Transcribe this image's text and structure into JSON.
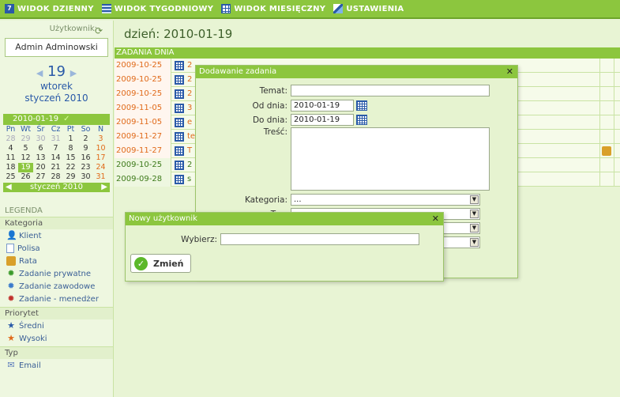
{
  "topmenu": {
    "items": [
      {
        "label": "WIDOK DZIENNY",
        "icon": "day-view-icon"
      },
      {
        "label": "WIDOK TYGODNIOWY",
        "icon": "week-view-icon"
      },
      {
        "label": "WIDOK MIESIĘCZNY",
        "icon": "month-view-icon"
      },
      {
        "label": "USTAWIENIA",
        "icon": "settings-icon"
      }
    ]
  },
  "sidebar": {
    "user_label": "Użytkownik:",
    "user_name": "Admin Adminowski",
    "day_number": "19",
    "weekday": "wtorek",
    "month_year": "styczeń 2010",
    "mini_calendar": {
      "current_date": "2010-01-19",
      "weekdays": [
        "Pn",
        "Wt",
        "Śr",
        "Cz",
        "Pt",
        "So",
        "N"
      ],
      "weeks": [
        [
          "28",
          "29",
          "30",
          "31",
          "1",
          "2",
          "3"
        ],
        [
          "4",
          "5",
          "6",
          "7",
          "8",
          "9",
          "10"
        ],
        [
          "11",
          "12",
          "13",
          "14",
          "15",
          "16",
          "17"
        ],
        [
          "18",
          "19",
          "20",
          "21",
          "22",
          "23",
          "24"
        ],
        [
          "25",
          "26",
          "27",
          "28",
          "29",
          "30",
          "31"
        ]
      ],
      "footer_month": "styczeń 2010"
    },
    "legend": {
      "title": "LEGENDA",
      "category_header": "Kategoria",
      "categories": [
        "Klient",
        "Polisa",
        "Rata",
        "Zadanie prywatne",
        "Zadanie zawodowe",
        "Zadanie - menedżer"
      ],
      "priority_header": "Priorytet",
      "priorities": [
        "Średni",
        "Wysoki"
      ],
      "type_header": "Typ",
      "types": [
        "Email"
      ]
    }
  },
  "main": {
    "date_title": "dzień: 2010-01-19",
    "tasks_header": "ZADANIA DNIA",
    "tasks": [
      {
        "date": "2009-10-25",
        "title": "2",
        "style": "orange"
      },
      {
        "date": "2009-10-25",
        "title": "2",
        "style": "orange"
      },
      {
        "date": "2009-10-25",
        "title": "2",
        "style": "orange"
      },
      {
        "date": "2009-11-05",
        "title": "3",
        "style": "orange"
      },
      {
        "date": "2009-11-05",
        "title": "e",
        "style": "orange"
      },
      {
        "date": "2009-11-27",
        "title": "te",
        "style": "orange"
      },
      {
        "date": "2009-11-27",
        "title": "T",
        "style": "orange"
      },
      {
        "date": "2009-10-25",
        "title": "2",
        "style": "green"
      },
      {
        "date": "2009-09-28",
        "title": "s",
        "style": "green"
      }
    ]
  },
  "add_dialog": {
    "title": "Dodawanie zadania",
    "temat_label": "Temat:",
    "temat_value": "",
    "od_label": "Od dnia:",
    "od_value": "2010-01-19",
    "do_label": "Do dnia:",
    "do_value": "2010-01-19",
    "tresc_label": "Treść:",
    "kategoria_label": "Kategoria:",
    "kategoria_value": "...",
    "typ_label": "Typ:"
  },
  "user_dialog": {
    "title": "Nowy użytkownik",
    "wybierz_label": "Wybierz:",
    "wybierz_value": "",
    "change_button": "Zmień"
  }
}
